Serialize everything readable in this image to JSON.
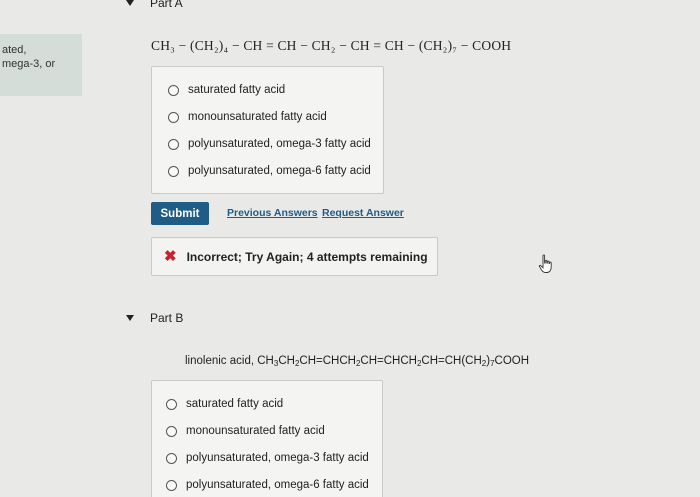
{
  "sidebar": {
    "line1": "ated,",
    "line2": "mega-3, or"
  },
  "part_a": {
    "header": "Part A",
    "formula": "CH₃ − (CH₂)₄ − CH = CH − CH₂ − CH = CH − (CH₂)₇ − COOH",
    "options": [
      "saturated fatty acid",
      "monounsaturated fatty acid",
      "polyunsaturated, omega-3 fatty acid",
      "polyunsaturated, omega-6 fatty acid"
    ],
    "submit_label": "Submit",
    "previous_answers_label": "Previous Answers",
    "request_answer_label": "Request Answer",
    "feedback": "Incorrect; Try Again; 4 attempts remaining"
  },
  "part_b": {
    "header": "Part B",
    "question_prefix": "linolenic acid, CH",
    "question_parts": [
      "3",
      "CH",
      "2",
      "CH=CHCH",
      "2",
      "CH=CHCH",
      "2",
      "CH=CH(CH",
      "2",
      ")",
      "7",
      "COOH"
    ],
    "options": [
      "saturated fatty acid",
      "monounsaturated fatty acid",
      "polyunsaturated, omega-3 fatty acid",
      "polyunsaturated, omega-6 fatty acid"
    ]
  },
  "colors": {
    "accent": "#1f5c86",
    "error": "#c8232c",
    "background": "#e9e9e7"
  }
}
